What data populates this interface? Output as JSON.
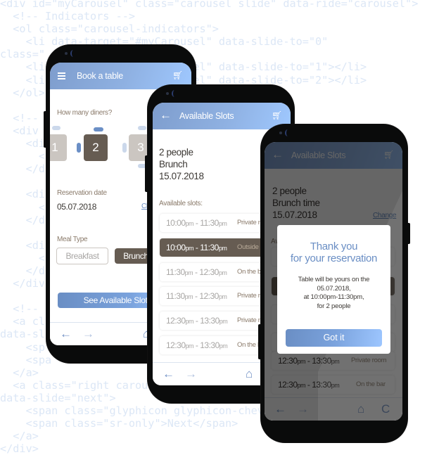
{
  "background_code": [
    "<div id=\"myCarousel\" class=\"carousel slide\" data-ride=\"carousel\">",
    "  <!-- Indicators -->",
    "  <ol class=\"carousel-indicators\">",
    "    <li data-target=\"#myCarousel\" data-slide-to=\"0\"",
    "class=\"",
    "    <li data-target=\"#myCarousel\" data-slide-to=\"1\"></li>",
    "    <li data-target=\"#myCarousel\" data-slide-to=\"2\"></li>",
    "  </ol>",
    "",
    "  <!--",
    "  <div",
    "    <div",
    "      <",
    "    </div",
    "",
    "    <div",
    "      <",
    "    </div",
    "",
    "    <div",
    "      <",
    "    </div",
    "  </div",
    "",
    "  <!--",
    "  <a cl",
    "data-sl",
    "    <sp",
    "    <spa",
    "  </a>",
    "  <a class=\"right carousel",
    "data-slide=\"next\">",
    "    <span class=\"glyphicon glyphicon-chevron-right\">",
    "    <span class=\"sr-only\">Next</span>",
    "  </a>",
    "</div>"
  ],
  "colors": {
    "accent_blue": "#6a8ec4",
    "selected_brown": "#665c52",
    "label_brown": "#8a7a6a"
  },
  "phone1": {
    "header": {
      "title": "Book a table",
      "menu_icon": "hamburger-icon",
      "cart_icon": "cart-icon"
    },
    "diners_label": "How many diners?",
    "diners": [
      {
        "value": "1",
        "selected": false
      },
      {
        "value": "2",
        "selected": true
      },
      {
        "value": "3",
        "selected": false
      }
    ],
    "date_label": "Reservation date",
    "date_value": "05.07.2018",
    "change_link": "Change",
    "meal_label": "Meal Type",
    "meal_options": [
      {
        "label": "Breakfast",
        "selected": false
      },
      {
        "label": "Brunch",
        "selected": true
      }
    ],
    "cta": "See Available Slots",
    "nav": {
      "back": "←",
      "forward": "→",
      "home": "⌂"
    }
  },
  "phone2": {
    "header": {
      "title": "Available Slots",
      "back_icon": "←",
      "cart_icon": "cart-icon"
    },
    "summary": [
      "2 people",
      "Brunch",
      "15.07.2018"
    ],
    "slots_label": "Available slots:",
    "slots": [
      {
        "start": "10:00",
        "start_suffix": "pm",
        "end": "11:30",
        "end_suffix": "pm",
        "location": "Private room",
        "selected": false
      },
      {
        "start": "10:00",
        "start_suffix": "pm",
        "end": "11:30",
        "end_suffix": "pm",
        "location": "Outside",
        "selected": true
      },
      {
        "start": "11:30",
        "start_suffix": "pm",
        "end": "12:30",
        "end_suffix": "pm",
        "location": "On the bar",
        "selected": false
      },
      {
        "start": "11:30",
        "start_suffix": "pm",
        "end": "12:30",
        "end_suffix": "pm",
        "location": "Private room",
        "selected": false
      },
      {
        "start": "12:30",
        "start_suffix": "pm",
        "end": "13:30",
        "end_suffix": "pm",
        "location": "Private room",
        "selected": false
      },
      {
        "start": "12:30",
        "start_suffix": "pm",
        "end": "13:30",
        "end_suffix": "pm",
        "location": "On the bar",
        "selected": false
      }
    ],
    "nav": {
      "back": "←",
      "forward": "→",
      "home": "⌂"
    }
  },
  "phone3": {
    "header": {
      "title": "Available Slots",
      "back_icon": "←",
      "cart_icon": "cart-icon"
    },
    "summary": [
      "2 people",
      "Brunch time",
      "15.07.2018"
    ],
    "change_link": "Change",
    "slots_label": "Available slots:",
    "slots_visible": [
      {
        "start": "12:30",
        "start_suffix": "pm",
        "end": "13:30",
        "end_suffix": "pm",
        "location": "Private room"
      },
      {
        "start": "12:30",
        "start_suffix": "pm",
        "end": "13:30",
        "end_suffix": "pm",
        "location": "On the bar"
      }
    ],
    "modal": {
      "title_line1": "Thank you",
      "title_line2": "for your reservation",
      "body_line1": "Table will be yours on the",
      "body_line2": "05.07.2018,",
      "body_line3": "at 10:00pm-11:30pm,",
      "body_line4": "for 2 people",
      "button": "Got it"
    },
    "nav": {
      "back": "←",
      "forward": "→",
      "home": "⌂",
      "refresh": "C"
    }
  }
}
